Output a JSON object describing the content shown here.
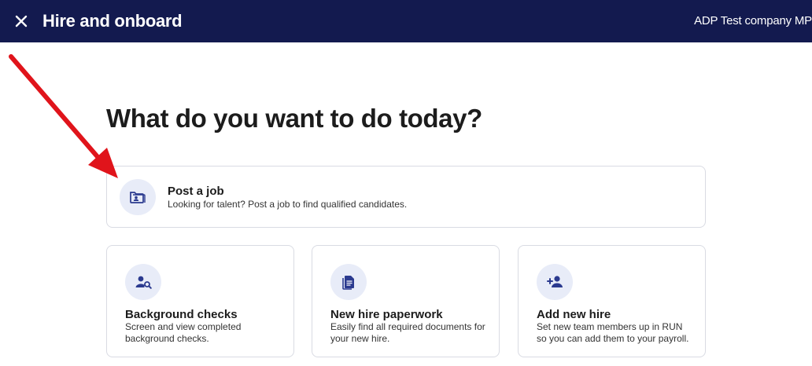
{
  "header": {
    "title": "Hire and onboard",
    "company": "ADP Test company MP",
    "background": "#131a4f"
  },
  "main": {
    "heading": "What do you want to do today?",
    "primary_card": {
      "title": "Post a job",
      "description": "Looking for talent? Post a job to find qualified candidates.",
      "icon": "folder-person-icon"
    },
    "cards": [
      {
        "title": "Background checks",
        "description": "Screen and view completed background checks.",
        "icon": "person-search-icon"
      },
      {
        "title": "New hire paperwork",
        "description": "Easily find all required documents for your new hire.",
        "icon": "document-icon"
      },
      {
        "title": "Add new hire",
        "description": "Set new team members up in RUN so you can add them to your payroll.",
        "icon": "person-add-icon"
      }
    ]
  },
  "colors": {
    "accent": "#2b3a8f",
    "icon_bg": "#e8ecf8",
    "annotation_arrow": "#e0141b"
  }
}
